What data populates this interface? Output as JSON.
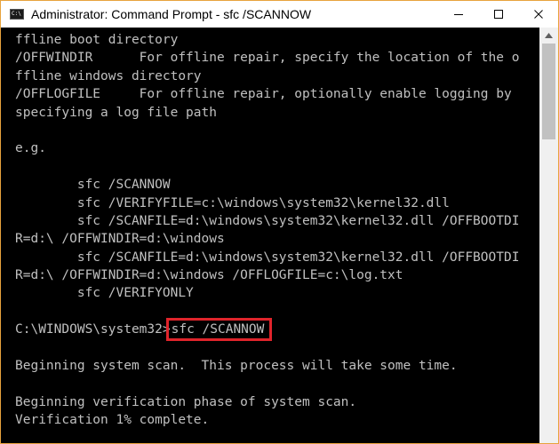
{
  "window": {
    "title": "Administrator: Command Prompt - sfc  /SCANNOW",
    "icon": "cmd-console-icon",
    "controls": {
      "minimize_icon": "minimize-icon",
      "maximize_icon": "maximize-icon",
      "close_icon": "close-icon"
    }
  },
  "console": {
    "lines": [
      "ffline boot directory",
      "/OFFWINDIR      For offline repair, specify the location of the o",
      "ffline windows directory",
      "/OFFLOGFILE     For offline repair, optionally enable logging by",
      "specifying a log file path",
      "",
      "e.g.",
      "",
      "        sfc /SCANNOW",
      "        sfc /VERIFYFILE=c:\\windows\\system32\\kernel32.dll",
      "        sfc /SCANFILE=d:\\windows\\system32\\kernel32.dll /OFFBOOTDI",
      "R=d:\\ /OFFWINDIR=d:\\windows",
      "        sfc /SCANFILE=d:\\windows\\system32\\kernel32.dll /OFFBOOTDI",
      "R=d:\\ /OFFWINDIR=d:\\windows /OFFLOGFILE=c:\\log.txt",
      "        sfc /VERIFYONLY",
      ""
    ],
    "prompt": {
      "path": "C:\\WINDOWS\\system32>",
      "command": "sfc /SCANNOW"
    },
    "output": [
      "",
      "Beginning system scan.  This process will take some time.",
      "",
      "Beginning verification phase of system scan.",
      "Verification 1% complete."
    ],
    "text_color": "#c0c0c0",
    "background_color": "#000000",
    "highlight_color": "#e0242b"
  }
}
